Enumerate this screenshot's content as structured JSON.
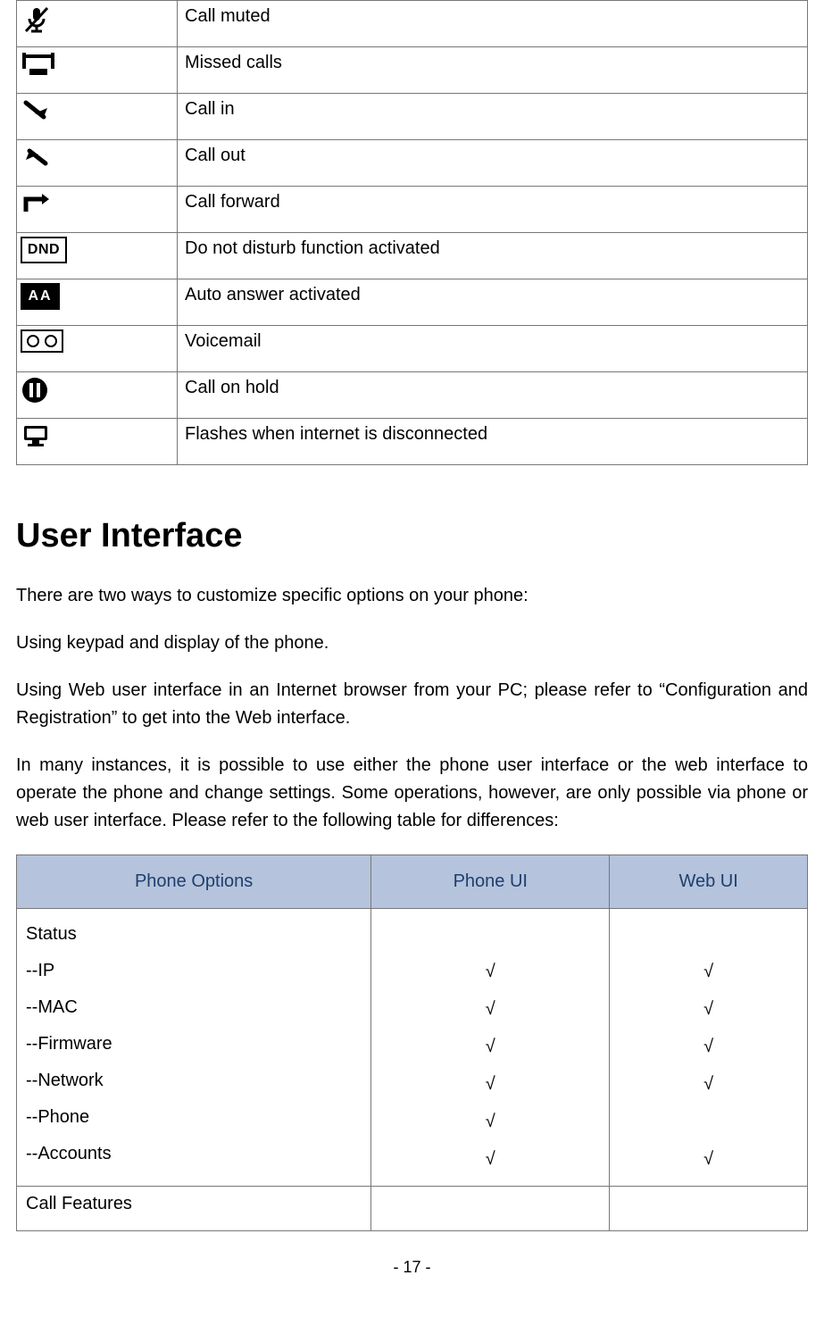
{
  "icon_rows": [
    {
      "label": "Call muted"
    },
    {
      "label": "Missed calls"
    },
    {
      "label": "Call in"
    },
    {
      "label": "Call out"
    },
    {
      "label": "Call forward"
    },
    {
      "label": "Do not disturb function activated"
    },
    {
      "label": "Auto answer activated"
    },
    {
      "label": "Voicemail"
    },
    {
      "label": "Call on hold"
    },
    {
      "label": "Flashes when internet is disconnected"
    }
  ],
  "section_title": "User Interface",
  "paragraphs": {
    "p1": "There are two ways to customize specific options on your phone:",
    "p2": "Using keypad and display of the phone.",
    "p3": "Using Web user interface in an Internet browser from your PC; please refer to “Configuration and Registration” to get into the Web interface.",
    "p4": "In many instances, it is possible to use either the phone user interface or the web interface to operate the phone and change settings. Some operations, however, are only possible via phone or web user interface. Please refer to the following table for differences:"
  },
  "opts_header": {
    "c1": "Phone Options",
    "c2": "Phone UI",
    "c3": "Web UI"
  },
  "status_group_title": "Status",
  "status_items": [
    {
      "name": "--IP",
      "phone": "√",
      "web": "√"
    },
    {
      "name": "--MAC",
      "phone": "√",
      "web": "√"
    },
    {
      "name": "--Firmware",
      "phone": "√",
      "web": "√"
    },
    {
      "name": "--Network",
      "phone": "√",
      "web": "√"
    },
    {
      "name": "--Phone",
      "phone": "√",
      "web": ""
    },
    {
      "name": "--Accounts",
      "phone": "√",
      "web": "√"
    }
  ],
  "call_features_row": "Call Features",
  "page_number": "- 17 -"
}
